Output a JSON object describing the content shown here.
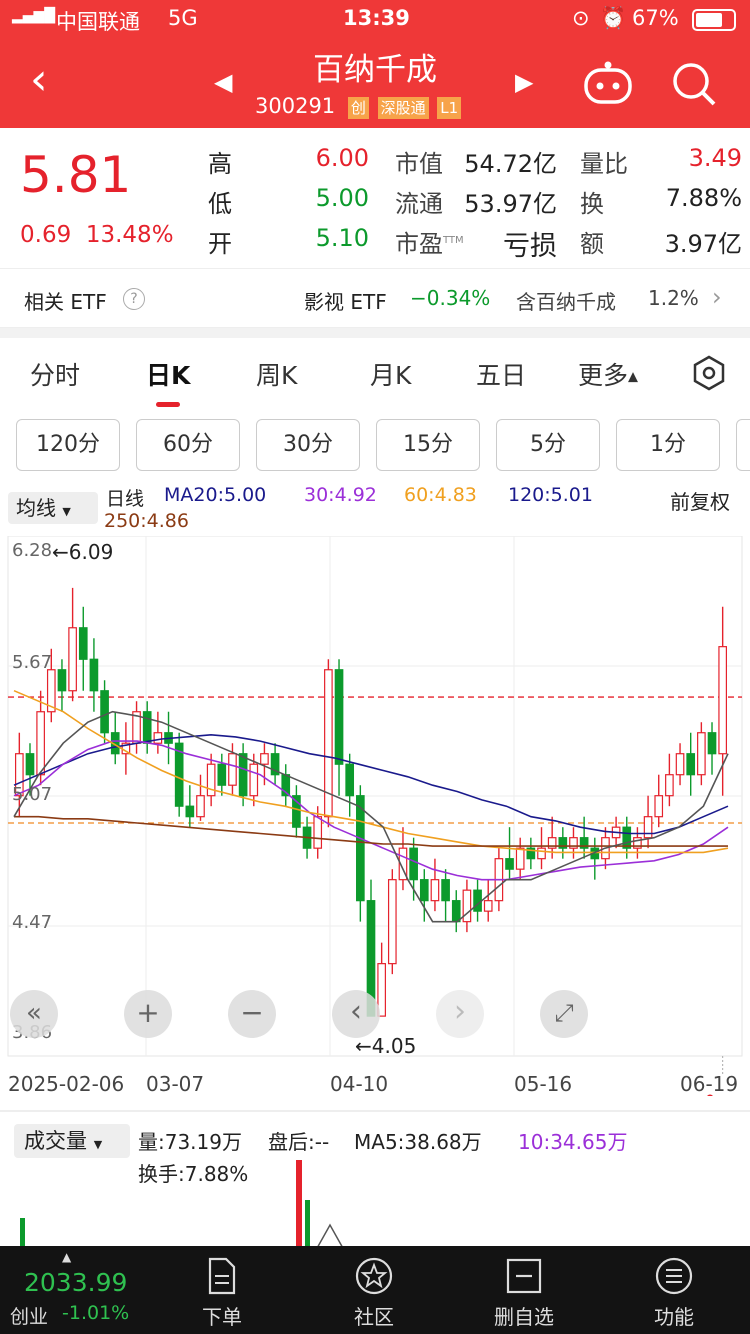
{
  "status_bar": {
    "carrier": "中国联通",
    "network": "5G",
    "time": "13:39",
    "battery": "67%"
  },
  "header": {
    "title": "百纳千成",
    "code": "300291",
    "badges": [
      "创",
      "深股通",
      "L1"
    ]
  },
  "quote": {
    "price": "5.81",
    "change": "0.69",
    "change_pct": "13.48%"
  },
  "stats": [
    {
      "label": "高",
      "value": "6.00",
      "color": "red"
    },
    {
      "label": "低",
      "value": "5.00",
      "color": "green"
    },
    {
      "label": "开",
      "value": "5.10",
      "color": "green"
    }
  ],
  "stats2": [
    {
      "label": "市值",
      "value": "54.72亿"
    },
    {
      "label": "流通",
      "value": "53.97亿"
    },
    {
      "label": "市盈",
      "sup": "TTM",
      "value": "亏损"
    }
  ],
  "stats3": [
    {
      "label": "量比",
      "value": "3.49",
      "color": "red"
    },
    {
      "label": "换",
      "value": "7.88%"
    },
    {
      "label": "额",
      "value": "3.97亿"
    }
  ],
  "etf": {
    "label": "相关 ETF",
    "name": "影视 ETF",
    "change": "−0.34%",
    "holding_label": "含百纳千成",
    "holding_pct": "1.2%"
  },
  "tabs": [
    "分时",
    "日K",
    "周K",
    "月K",
    "五日",
    "更多"
  ],
  "active_tab": "日K",
  "minute_buttons": [
    "120分",
    "60分",
    "30分",
    "15分",
    "5分",
    "1分"
  ],
  "ma": {
    "selector": "均线",
    "period": "日线",
    "ma20": "MA20:5.00",
    "ma30": "30:4.92",
    "ma60": "60:4.83",
    "ma120": "120:5.01",
    "ma250": "250:4.86",
    "adjust": "前复权"
  },
  "chart_data": {
    "type": "candlestick",
    "y_ticks": [
      "6.28",
      "5.67",
      "5.07",
      "4.47",
      "3.86"
    ],
    "x_ticks": [
      "2025-02-06",
      "03-07",
      "04-10",
      "05-16",
      "06-19"
    ],
    "high_annotation": "←6.09",
    "low_annotation": "←4.05",
    "ylim": [
      3.86,
      6.28
    ],
    "reference_lines": [
      5.57,
      4.97
    ],
    "candles": [
      [
        5.1,
        5.3,
        5.4,
        5.0
      ],
      [
        5.3,
        5.2,
        5.35,
        5.1
      ],
      [
        5.2,
        5.5,
        5.6,
        5.15
      ],
      [
        5.5,
        5.7,
        5.8,
        5.45
      ],
      [
        5.7,
        5.6,
        5.75,
        5.5
      ],
      [
        5.6,
        5.9,
        6.09,
        5.55
      ],
      [
        5.9,
        5.75,
        6.0,
        5.6
      ],
      [
        5.75,
        5.6,
        5.85,
        5.5
      ],
      [
        5.6,
        5.4,
        5.65,
        5.35
      ],
      [
        5.4,
        5.3,
        5.5,
        5.25
      ],
      [
        5.3,
        5.35,
        5.45,
        5.2
      ],
      [
        5.35,
        5.5,
        5.55,
        5.3
      ],
      [
        5.5,
        5.35,
        5.55,
        5.3
      ],
      [
        5.35,
        5.4,
        5.5,
        5.3
      ],
      [
        5.4,
        5.35,
        5.5,
        5.25
      ],
      [
        5.35,
        5.05,
        5.4,
        5.0
      ],
      [
        5.05,
        5.0,
        5.15,
        4.95
      ],
      [
        5.0,
        5.1,
        5.2,
        4.98
      ],
      [
        5.1,
        5.25,
        5.3,
        5.05
      ],
      [
        5.25,
        5.15,
        5.3,
        5.1
      ],
      [
        5.15,
        5.3,
        5.35,
        5.1
      ],
      [
        5.3,
        5.1,
        5.35,
        5.05
      ],
      [
        5.1,
        5.25,
        5.3,
        5.05
      ],
      [
        5.25,
        5.3,
        5.35,
        5.15
      ],
      [
        5.3,
        5.2,
        5.35,
        5.15
      ],
      [
        5.2,
        5.1,
        5.25,
        5.05
      ],
      [
        5.1,
        4.95,
        5.15,
        4.9
      ],
      [
        4.95,
        4.85,
        5.0,
        4.8
      ],
      [
        4.85,
        5.0,
        5.05,
        4.8
      ],
      [
        5.0,
        5.7,
        5.75,
        4.95
      ],
      [
        5.7,
        5.25,
        5.75,
        5.1
      ],
      [
        5.25,
        5.1,
        5.3,
        5.0
      ],
      [
        5.1,
        4.6,
        5.15,
        4.5
      ],
      [
        4.6,
        4.05,
        4.7,
        4.05
      ],
      [
        4.05,
        4.3,
        4.4,
        4.05
      ],
      [
        4.3,
        4.7,
        4.75,
        4.25
      ],
      [
        4.7,
        4.85,
        4.95,
        4.65
      ],
      [
        4.85,
        4.7,
        4.9,
        4.6
      ],
      [
        4.7,
        4.6,
        4.75,
        4.5
      ],
      [
        4.6,
        4.7,
        4.8,
        4.55
      ],
      [
        4.7,
        4.6,
        4.75,
        4.5
      ],
      [
        4.6,
        4.5,
        4.65,
        4.45
      ],
      [
        4.5,
        4.65,
        4.7,
        4.45
      ],
      [
        4.65,
        4.55,
        4.7,
        4.5
      ],
      [
        4.55,
        4.6,
        4.7,
        4.5
      ],
      [
        4.6,
        4.8,
        4.85,
        4.55
      ],
      [
        4.8,
        4.75,
        4.95,
        4.7
      ],
      [
        4.75,
        4.85,
        4.9,
        4.7
      ],
      [
        4.85,
        4.8,
        4.9,
        4.75
      ],
      [
        4.8,
        4.85,
        4.95,
        4.75
      ],
      [
        4.85,
        4.9,
        5.0,
        4.8
      ],
      [
        4.9,
        4.85,
        4.95,
        4.8
      ],
      [
        4.85,
        4.9,
        4.95,
        4.8
      ],
      [
        4.9,
        4.85,
        5.0,
        4.8
      ],
      [
        4.85,
        4.8,
        4.9,
        4.7
      ],
      [
        4.8,
        4.9,
        4.95,
        4.75
      ],
      [
        4.9,
        4.95,
        5.0,
        4.85
      ],
      [
        4.95,
        4.85,
        5.0,
        4.8
      ],
      [
        4.85,
        4.9,
        4.95,
        4.8
      ],
      [
        4.9,
        5.0,
        5.1,
        4.85
      ],
      [
        5.0,
        5.1,
        5.2,
        4.95
      ],
      [
        5.1,
        5.2,
        5.3,
        5.05
      ],
      [
        5.2,
        5.3,
        5.35,
        5.15
      ],
      [
        5.3,
        5.2,
        5.4,
        5.1
      ],
      [
        5.2,
        5.4,
        5.45,
        5.15
      ],
      [
        5.4,
        5.3,
        5.45,
        5.2
      ],
      [
        5.3,
        5.81,
        6.0,
        5.1
      ]
    ],
    "ma_series": [
      {
        "name": "MA20",
        "color": "#1a1a8c",
        "values": [
          5.15,
          5.2,
          5.25,
          5.3,
          5.33,
          5.35,
          5.37,
          5.38,
          5.39,
          5.38,
          5.36,
          5.33,
          5.3,
          5.28,
          5.25,
          5.22,
          5.19,
          5.15,
          5.12,
          5.08,
          5.05,
          5.0,
          4.98,
          4.95,
          4.93,
          4.92,
          4.92,
          4.95,
          5.0,
          5.05
        ]
      },
      {
        "name": "MA30",
        "color": "#9b2fd8",
        "values": [
          5.1,
          5.15,
          5.25,
          5.32,
          5.36,
          5.36,
          5.34,
          5.3,
          5.27,
          5.24,
          5.2,
          5.12,
          5.02,
          4.95,
          4.9,
          4.85,
          4.8,
          4.75,
          4.72,
          4.7,
          4.7,
          4.72,
          4.74,
          4.76,
          4.77,
          4.78,
          4.79,
          4.82,
          4.87,
          4.95
        ]
      },
      {
        "name": "MA60",
        "color": "#f0a020",
        "values": [
          5.6,
          5.55,
          5.5,
          5.42,
          5.35,
          5.28,
          5.22,
          5.17,
          5.13,
          5.1,
          5.07,
          5.05,
          5.02,
          5.0,
          4.98,
          4.95,
          4.92,
          4.9,
          4.88,
          4.86,
          4.85,
          4.84,
          4.83,
          4.83,
          4.83,
          4.83,
          4.83,
          4.83,
          4.83,
          4.85
        ]
      },
      {
        "name": "MA250",
        "color": "#8b3b14",
        "values": [
          5.0,
          5.0,
          4.99,
          4.99,
          4.98,
          4.97,
          4.96,
          4.95,
          4.94,
          4.93,
          4.92,
          4.91,
          4.9,
          4.89,
          4.88,
          4.87,
          4.87,
          4.86,
          4.86,
          4.86,
          4.86,
          4.86,
          4.86,
          4.86,
          4.86,
          4.86,
          4.86,
          4.86,
          4.86,
          4.86
        ]
      },
      {
        "name": "MA5",
        "color": "#555555",
        "values": [
          5.0,
          5.2,
          5.35,
          5.45,
          5.5,
          5.48,
          5.45,
          5.4,
          5.35,
          5.3,
          5.25,
          5.2,
          5.15,
          5.1,
          5.05,
          4.95,
          4.7,
          4.5,
          4.5,
          4.6,
          4.7,
          4.7,
          4.75,
          4.8,
          4.85,
          4.88,
          4.9,
          4.95,
          5.05,
          5.3
        ]
      }
    ]
  },
  "chart_nav": [
    "«",
    "+",
    "−",
    "‹",
    "›",
    "⤢"
  ],
  "volume": {
    "selector": "成交量",
    "vol": "量:73.19万",
    "after": "盘后:--",
    "ma5": "MA5:38.68万",
    "ma10": "10:34.65万",
    "turnover": "换手:7.88%"
  },
  "tabbar": {
    "index_value": "2033.99",
    "index_name": "创业",
    "index_change": "-1.01%",
    "items": [
      "下单",
      "社区",
      "删自选",
      "功能"
    ]
  }
}
